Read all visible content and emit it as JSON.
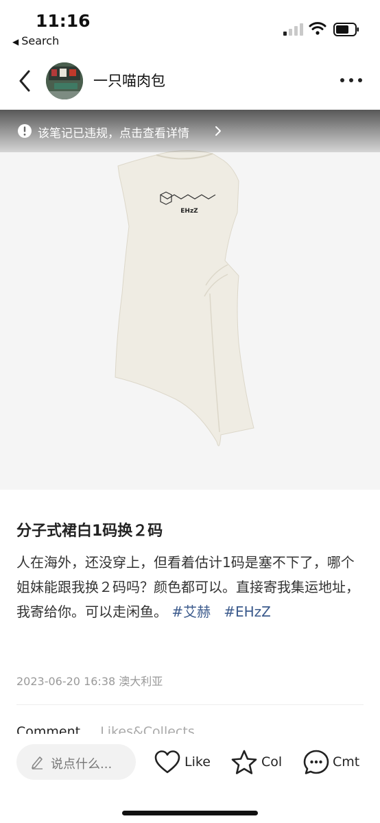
{
  "status_bar": {
    "time": "11:16",
    "back_app_label": "Search"
  },
  "header": {
    "username": "一只喵肉包",
    "back_icon": "chevron-left-icon",
    "more_icon": "more-horizontal-icon"
  },
  "image": {
    "violation_text": "该笔记已违规，点击查看详情",
    "shirt_print": "EHzZ"
  },
  "post": {
    "title": "分子式裙白1码换２码",
    "body": "人在海外，还没穿上，但看着估计1码是塞不下了，哪个姐妹能跟我换２码吗？颜色都可以。直接寄我集运地址，我寄给你。可以走闲鱼。",
    "tags": [
      "#艾赫",
      "#EHzZ"
    ],
    "date": "2023-06-20 16:38",
    "location": "澳大利亚"
  },
  "tabs": {
    "comment": "Comment",
    "likes_collects": "Likes&Collects"
  },
  "bottom_bar": {
    "comment_placeholder": "说点什么...",
    "like_label": "Like",
    "collect_label": "Col",
    "comment_label": "Cmt"
  },
  "colors": {
    "tag": "#3b5a8c",
    "meta": "#999999",
    "banner": "#555555"
  }
}
